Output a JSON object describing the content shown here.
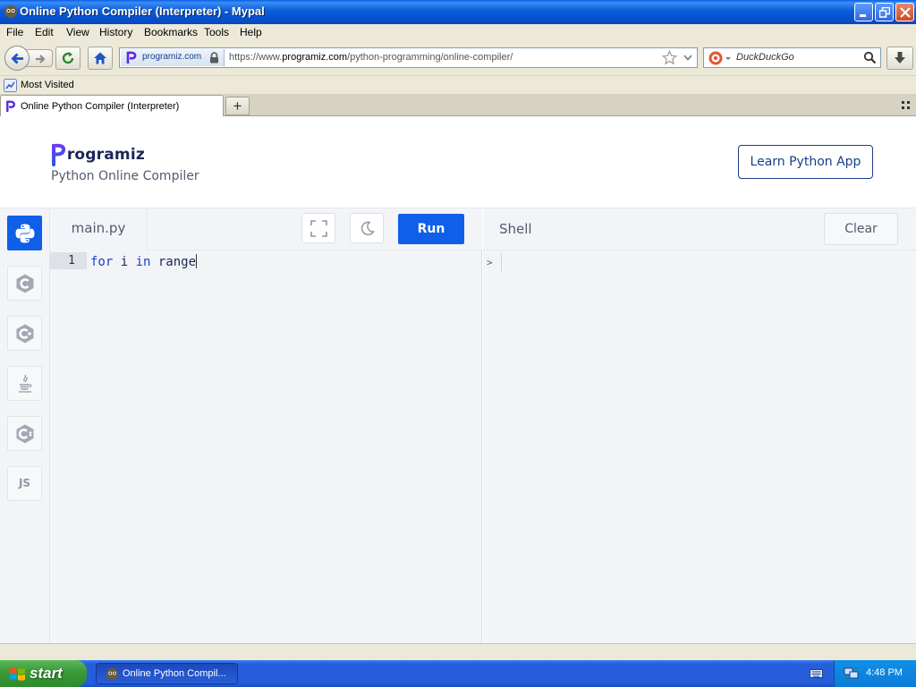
{
  "window": {
    "title": "Online Python Compiler (Interpreter) - Mypal"
  },
  "menu": {
    "items": [
      "File",
      "Edit",
      "View",
      "History",
      "Bookmarks",
      "Tools",
      "Help"
    ]
  },
  "navbar": {
    "identity_domain": "programiz.com",
    "url_prefix": "https://www.",
    "url_host": "programiz.com",
    "url_path": "/python-programming/online-compiler/",
    "search_placeholder": "DuckDuckGo"
  },
  "bookmarks": {
    "most_visited": "Most Visited"
  },
  "tabs": [
    {
      "label": "Online Python Compiler (Interpreter)",
      "active": true
    }
  ],
  "site": {
    "logo_text": "rogramiz",
    "subtitle": "Python Online Compiler",
    "learn_app_label": "Learn Python App"
  },
  "languages": [
    "python",
    "c",
    "cpp",
    "java",
    "csharp",
    "JS"
  ],
  "editor": {
    "file_name": "main.py",
    "run_label": "Run",
    "line_number": "1",
    "code": {
      "kw1": "for",
      "mid": " i ",
      "kw2": "in",
      "rest": " range"
    }
  },
  "shell": {
    "label": "Shell",
    "clear_label": "Clear",
    "prompt": ">"
  },
  "taskbar": {
    "start_label": "start",
    "task_label": "Online Python Compil...",
    "clock": "4:48 PM"
  },
  "colors": {
    "accent": "#0f5fe8",
    "brand_dark": "#1a2756",
    "xp_blue": "#245edb"
  }
}
